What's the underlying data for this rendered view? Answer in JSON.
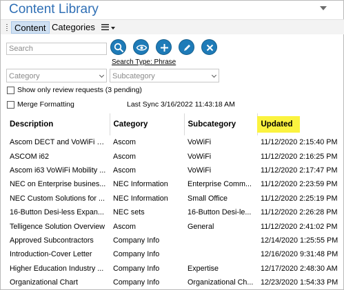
{
  "app": {
    "title": "Content Library"
  },
  "tabs": [
    {
      "label": "Content"
    },
    {
      "label": "Categories"
    }
  ],
  "search": {
    "placeholder": "Search",
    "value": "",
    "type_label": "Search Type: Phrase"
  },
  "toolbar": {
    "accent": "#1e7bb8",
    "buttons": [
      "search-icon",
      "eye-icon",
      "plus-icon",
      "pencil-icon",
      "close-icon"
    ]
  },
  "filters": {
    "category_placeholder": "Category",
    "subcategory_placeholder": "Subcategory"
  },
  "options": {
    "review_label": "Show only review requests (3 pending)",
    "merge_label": "Merge Formatting"
  },
  "sync": {
    "text": "Last Sync 3/16/2022 11:43:18 AM"
  },
  "table": {
    "headers": [
      "Description",
      "Category",
      "Subcategory",
      "Updated"
    ],
    "highlight_color": "#fbf33f",
    "rows": [
      [
        "Ascom DECT and VoWiFi a...",
        "Ascom",
        "VoWiFi",
        "11/12/2020 2:15:40 PM"
      ],
      [
        "ASCOM i62",
        "Ascom",
        "VoWiFi",
        "11/12/2020 2:16:25 PM"
      ],
      [
        "Ascom i63 VoWiFi Mobility ...",
        "Ascom",
        "VoWiFi",
        "11/12/2020 2:17:47 PM"
      ],
      [
        "NEC on Enterprise busines...",
        "NEC Information",
        "Enterprise Comm...",
        "11/12/2020 2:23:59 PM"
      ],
      [
        "NEC Custom Solutions for ...",
        "NEC Information",
        "Small Office",
        "11/12/2020 2:25:19 PM"
      ],
      [
        "16-Button Desi-less Expan...",
        "NEC sets",
        "16-Button Desi-le...",
        "11/12/2020 2:26:28 PM"
      ],
      [
        "Telligence Solution Overview",
        "Ascom",
        "General",
        "11/12/2020 2:41:02 PM"
      ],
      [
        "Approved Subcontractors",
        "Company Info",
        "",
        "12/14/2020 1:25:55 PM"
      ],
      [
        "Introduction-Cover Letter",
        "Company Info",
        "",
        "12/16/2020 9:31:48 PM"
      ],
      [
        "Higher Education Industry ...",
        "Company Info",
        "Expertise",
        "12/17/2020 2:48:30 AM"
      ],
      [
        "Organizational Chart",
        "Company Info",
        "Organizational Ch...",
        "12/23/2020 1:54:33 PM"
      ]
    ]
  }
}
